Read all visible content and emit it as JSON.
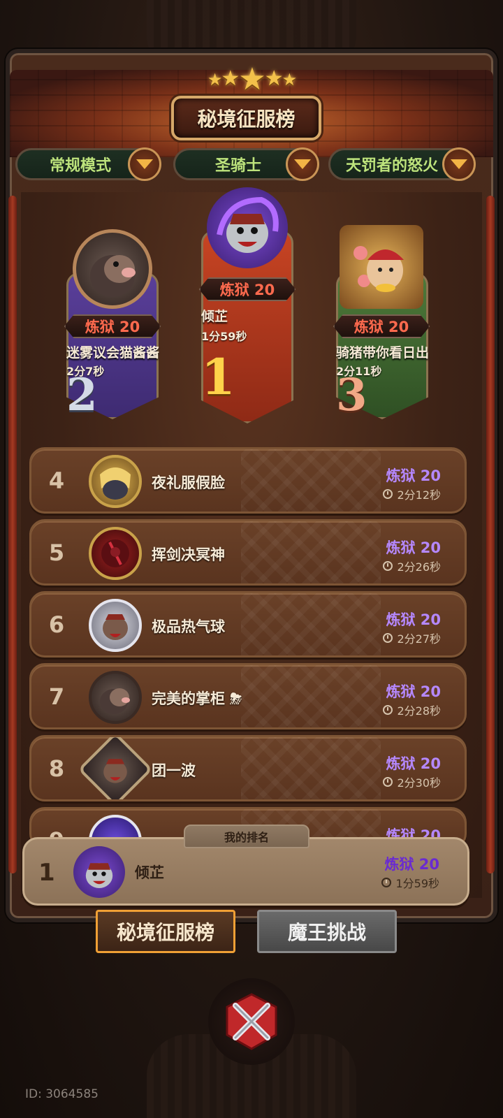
{
  "header": {
    "title": "秘境征服榜",
    "star_count": 5
  },
  "filters": [
    {
      "label": "常规模式"
    },
    {
      "label": "圣骑士"
    },
    {
      "label": "天罚者的怒火"
    }
  ],
  "podium": [
    {
      "rank": "1",
      "difficulty": "炼狱 20",
      "name": "倾芷",
      "time": "1分59秒"
    },
    {
      "rank": "2",
      "difficulty": "炼狱 20",
      "name": "迷雾议会猫酱酱",
      "time": "2分7秒"
    },
    {
      "rank": "3",
      "difficulty": "炼狱 20",
      "name": "骑猪带你看日出",
      "time": "2分11秒"
    }
  ],
  "rows": [
    {
      "rank": "4",
      "name": "夜礼服假脸",
      "difficulty": "炼狱 20",
      "time": "2分12秒"
    },
    {
      "rank": "5",
      "name": "挥剑决冥神",
      "difficulty": "炼狱 20",
      "time": "2分26秒"
    },
    {
      "rank": "6",
      "name": "极品热气球",
      "difficulty": "炼狱 20",
      "time": "2分27秒"
    },
    {
      "rank": "7",
      "name": "完美的掌柜",
      "difficulty": "炼狱 20",
      "time": "2分28秒"
    },
    {
      "rank": "8",
      "name": "团一波",
      "difficulty": "炼狱 20",
      "time": "2分30秒"
    },
    {
      "rank": "9",
      "name": "",
      "difficulty": "炼狱 20",
      "time": ""
    }
  ],
  "my_rank": {
    "label": "我的排名",
    "rank": "1",
    "name": "倾芷",
    "difficulty": "炼狱 20",
    "time": "1分59秒"
  },
  "tabs": [
    {
      "label": "秘境征服榜",
      "active": true
    },
    {
      "label": "魔王挑战",
      "active": false
    }
  ],
  "footer": {
    "id_text": "ID: 3064585"
  },
  "colors": {
    "accent": "#f0a035",
    "difficulty": "#b588ff",
    "podium_red": "#ff6a4e",
    "filter_text": "#bde37c"
  },
  "icons": [
    "star-icon",
    "dropdown-arrow-icon",
    "clock-icon",
    "storm-emoji-icon",
    "crossed-swords-icon"
  ]
}
